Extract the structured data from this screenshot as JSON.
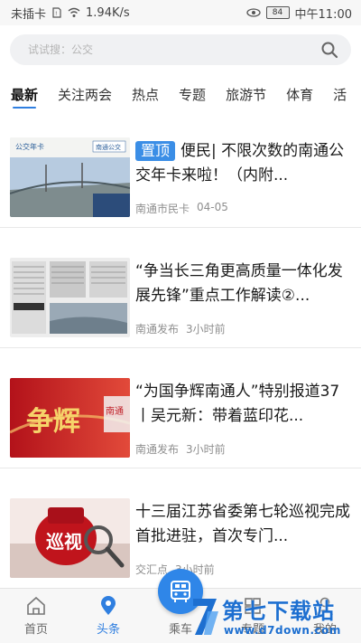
{
  "status_bar": {
    "sim": "未插卡",
    "speed": "1.94K/s",
    "battery": "84",
    "time": "中午11:00"
  },
  "search": {
    "placeholder": "试试搜：公交"
  },
  "tabs": [
    {
      "label": "最新",
      "active": true
    },
    {
      "label": "关注两会"
    },
    {
      "label": "热点"
    },
    {
      "label": "专题"
    },
    {
      "label": "旅游节"
    },
    {
      "label": "体育"
    },
    {
      "label": "活"
    }
  ],
  "articles": [
    {
      "badge": "置顶",
      "title": "便民| 不限次数的南通公交年卡来啦！（内附...",
      "source": "南通市民卡",
      "time": "04-05",
      "thumb_text": "公交年卡"
    },
    {
      "title": "“争当长三角更高质量一体化发展先锋”重点工作解读②...",
      "source": "南通发布",
      "time": "3小时前"
    },
    {
      "title": "“为国争辉南通人”特别报道37丨吴元新：带着蓝印花...",
      "source": "南通发布",
      "time": "3小时前",
      "thumb_text": "争辉"
    },
    {
      "title": "十三届江苏省委第七轮巡视完成首批进驻，首次专门...",
      "source": "交汇点",
      "time": "3小时前",
      "thumb_text": "巡视"
    }
  ],
  "bottom_nav": [
    {
      "label": "首页",
      "icon": "home-icon"
    },
    {
      "label": "头条",
      "icon": "location-icon",
      "active": true
    },
    {
      "label": "乘车",
      "icon": "bus-icon"
    },
    {
      "label": "专题",
      "icon": "grid-icon"
    },
    {
      "label": "我的",
      "icon": "user-icon"
    }
  ],
  "watermark": {
    "title": "第七下载站",
    "url": "www.d7down.com"
  },
  "colors": {
    "accent": "#2f7fe0",
    "badge": "#3b8ee6",
    "meta": "#8f8f8f"
  }
}
